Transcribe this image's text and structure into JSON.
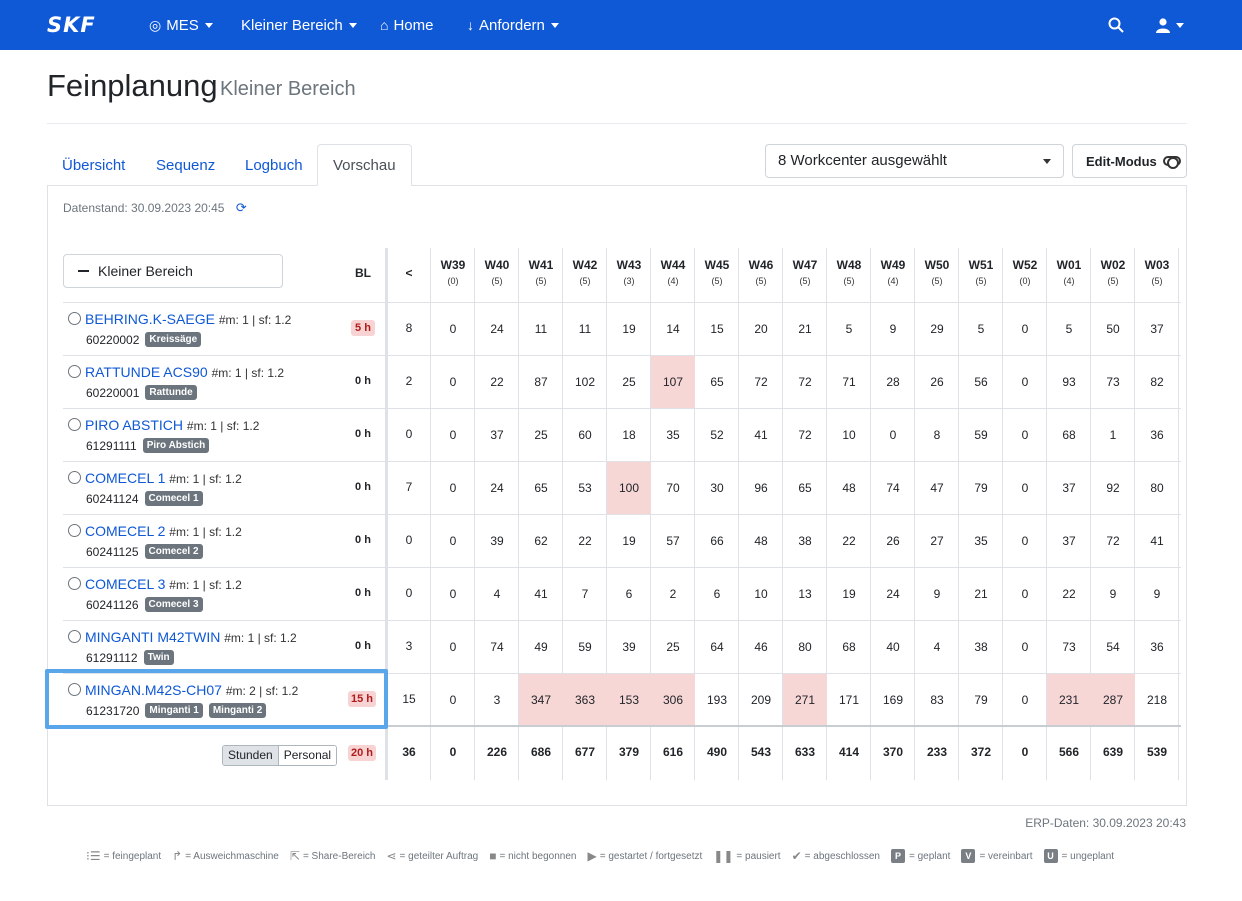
{
  "nav": {
    "brand": "SKF",
    "items": [
      {
        "label": "MES",
        "icon": "target-icon"
      },
      {
        "label": "Kleiner Bereich",
        "icon": ""
      },
      {
        "label": "Home",
        "icon": "home-icon"
      },
      {
        "label": "Anfordern",
        "icon": "arrow-down-icon"
      }
    ]
  },
  "page": {
    "title": "Feinplanung",
    "subtitle": "Kleiner Bereich"
  },
  "tabs": [
    {
      "label": "Übersicht"
    },
    {
      "label": "Sequenz"
    },
    {
      "label": "Logbuch"
    },
    {
      "label": "Vorschau"
    }
  ],
  "workcenter_select": "8 Workcenter ausgewählt",
  "edit_mode": "Edit-Modus",
  "datenstand": "Datenstand: 30.09.2023 20:45",
  "group_label": "Kleiner Bereich",
  "table": {
    "bl_header": "BL",
    "lt_header": "<",
    "weeks": [
      {
        "w": "W39",
        "c": "(0)"
      },
      {
        "w": "W40",
        "c": "(5)"
      },
      {
        "w": "W41",
        "c": "(5)"
      },
      {
        "w": "W42",
        "c": "(5)"
      },
      {
        "w": "W43",
        "c": "(3)"
      },
      {
        "w": "W44",
        "c": "(4)"
      },
      {
        "w": "W45",
        "c": "(5)"
      },
      {
        "w": "W46",
        "c": "(5)"
      },
      {
        "w": "W47",
        "c": "(5)"
      },
      {
        "w": "W48",
        "c": "(5)"
      },
      {
        "w": "W49",
        "c": "(4)"
      },
      {
        "w": "W50",
        "c": "(5)"
      },
      {
        "w": "W51",
        "c": "(5)"
      },
      {
        "w": "W52",
        "c": "(0)"
      },
      {
        "w": "W01",
        "c": "(4)"
      },
      {
        "w": "W02",
        "c": "(5)"
      },
      {
        "w": "W03",
        "c": "(5)"
      }
    ],
    "rows": [
      {
        "name": "BEHRING.K-SAEGE",
        "meta": "#m: 1 | sf: 1.2",
        "number": "60220002",
        "badges": [
          "Kreissäge"
        ],
        "bl": "5 h",
        "bl_warn": true,
        "lt": "8",
        "values": [
          "0",
          "24",
          "11",
          "11",
          "19",
          "14",
          "15",
          "20",
          "21",
          "5",
          "9",
          "29",
          "5",
          "0",
          "5",
          "50",
          "37"
        ],
        "hl": []
      },
      {
        "name": "RATTUNDE ACS90",
        "meta": "#m: 1 | sf: 1.2",
        "number": "60220001",
        "badges": [
          "Rattunde"
        ],
        "bl": "0 h",
        "bl_warn": false,
        "lt": "2",
        "values": [
          "0",
          "22",
          "87",
          "102",
          "25",
          "107",
          "65",
          "72",
          "72",
          "71",
          "28",
          "26",
          "56",
          "0",
          "93",
          "73",
          "82"
        ],
        "hl": [
          5
        ]
      },
      {
        "name": "PIRO ABSTICH",
        "meta": "#m: 1 | sf: 1.2",
        "number": "61291111",
        "badges": [
          "Piro Abstich"
        ],
        "bl": "0 h",
        "bl_warn": false,
        "lt": "0",
        "values": [
          "0",
          "37",
          "25",
          "60",
          "18",
          "35",
          "52",
          "41",
          "72",
          "10",
          "0",
          "8",
          "59",
          "0",
          "68",
          "1",
          "36"
        ],
        "hl": []
      },
      {
        "name": "COMECEL 1",
        "meta": "#m: 1 | sf: 1.2",
        "number": "60241124",
        "badges": [
          "Comecel 1"
        ],
        "bl": "0 h",
        "bl_warn": false,
        "lt": "7",
        "values": [
          "0",
          "24",
          "65",
          "53",
          "100",
          "70",
          "30",
          "96",
          "65",
          "48",
          "74",
          "47",
          "79",
          "0",
          "37",
          "92",
          "80"
        ],
        "hl": [
          4
        ]
      },
      {
        "name": "COMECEL 2",
        "meta": "#m: 1 | sf: 1.2",
        "number": "60241125",
        "badges": [
          "Comecel 2"
        ],
        "bl": "0 h",
        "bl_warn": false,
        "lt": "0",
        "values": [
          "0",
          "39",
          "62",
          "22",
          "19",
          "57",
          "66",
          "48",
          "38",
          "22",
          "26",
          "27",
          "35",
          "0",
          "37",
          "72",
          "41"
        ],
        "hl": []
      },
      {
        "name": "COMECEL 3",
        "meta": "#m: 1 | sf: 1.2",
        "number": "60241126",
        "badges": [
          "Comecel 3"
        ],
        "bl": "0 h",
        "bl_warn": false,
        "lt": "0",
        "values": [
          "0",
          "4",
          "41",
          "7",
          "6",
          "2",
          "6",
          "10",
          "13",
          "19",
          "24",
          "9",
          "21",
          "0",
          "22",
          "9",
          "9"
        ],
        "hl": []
      },
      {
        "name": "MINGANTI M42TWIN",
        "meta": "#m: 1 | sf: 1.2",
        "number": "61291112",
        "badges": [
          "Twin"
        ],
        "bl": "0 h",
        "bl_warn": false,
        "lt": "3",
        "values": [
          "0",
          "74",
          "49",
          "59",
          "39",
          "25",
          "64",
          "46",
          "80",
          "68",
          "40",
          "4",
          "38",
          "0",
          "73",
          "54",
          "36"
        ],
        "hl": []
      },
      {
        "name": "MINGAN.M42S-CH07",
        "meta": "#m: 2 | sf: 1.2",
        "number": "61231720",
        "badges": [
          "Minganti 1",
          "Minganti 2"
        ],
        "bl": "15 h",
        "bl_warn": true,
        "lt": "15",
        "values": [
          "0",
          "3",
          "347",
          "363",
          "153",
          "306",
          "193",
          "209",
          "271",
          "171",
          "169",
          "83",
          "79",
          "0",
          "231",
          "287",
          "218"
        ],
        "hl": [
          2,
          3,
          4,
          5,
          8,
          14,
          15
        ]
      }
    ],
    "totals": {
      "bl": "20 h",
      "lt": "36",
      "values": [
        "0",
        "226",
        "686",
        "677",
        "379",
        "616",
        "490",
        "543",
        "633",
        "414",
        "370",
        "233",
        "372",
        "0",
        "566",
        "639",
        "539"
      ]
    },
    "unit_toggle": {
      "active": "Stunden",
      "inactive": "Personal"
    }
  },
  "erp": "ERP-Daten: 30.09.2023 20:43",
  "legend": [
    {
      "icon": "list-icon",
      "glyph": "⁝☰",
      "text": "= feingeplant"
    },
    {
      "icon": "share-arrow-icon",
      "glyph": "↱",
      "text": "= Ausweichmaschine"
    },
    {
      "icon": "external-share-icon",
      "glyph": "⇱",
      "text": "= Share-Bereich"
    },
    {
      "icon": "share-nodes-icon",
      "glyph": "⋖",
      "text": "= geteilter Auftrag"
    },
    {
      "icon": "stop-icon",
      "glyph": "■",
      "text": "= nicht begonnen"
    },
    {
      "icon": "play-icon",
      "glyph": "▶",
      "text": "= gestartet / fortgesetzt"
    },
    {
      "icon": "pause-icon",
      "glyph": "❚❚",
      "text": "= pausiert"
    },
    {
      "icon": "check-icon",
      "glyph": "✔",
      "text": "= abgeschlossen"
    },
    {
      "icon": "p-badge-icon",
      "badge": "P",
      "text": "= geplant"
    },
    {
      "icon": "v-badge-icon",
      "badge": "V",
      "text": "= vereinbart"
    },
    {
      "icon": "u-badge-icon",
      "badge": "U",
      "text": "= ungeplant"
    }
  ]
}
